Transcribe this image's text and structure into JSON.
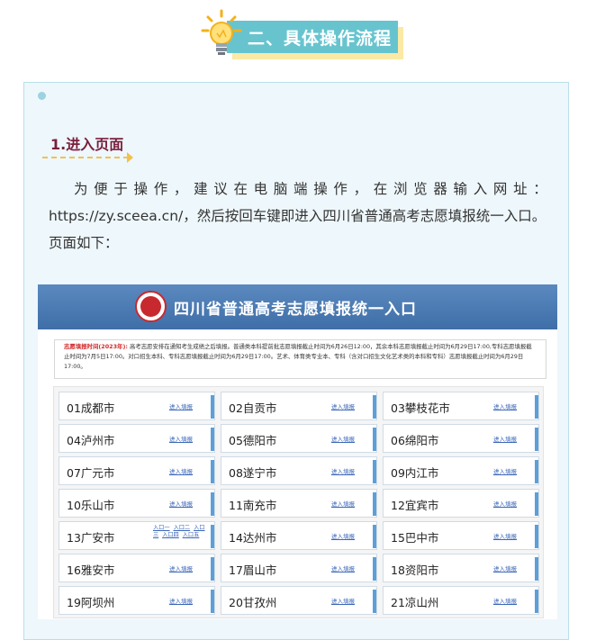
{
  "header": {
    "title": "二、具体操作流程",
    "bulb_icon": "lightbulb-icon",
    "accent_color": "#67c4cf",
    "shadow_color": "#fbe9a5"
  },
  "section": {
    "title": "1.进入页面",
    "title_color": "#7a1f3d",
    "para_line1": "为便于操作，建议在电脑端操作，在浏览器输入网址：",
    "para_rest": "https://zy.sceea.cn/，然后按回车键即进入四川省普通高考志愿填报统一入口。页面如下："
  },
  "screenshot": {
    "site_title": "四川省普通高考志愿填报统一入口",
    "notice_lead": "志愿填报时间(2023年):",
    "notice_text": " 高考志愿安排在通知考生成绩之后填报。普通类本科提前批志愿填报截止时间为6月26日12:00，其余本科志愿填报截止时间为6月29日17:00,专科志愿填报截止时间为7月5日17:00。对口招生本科、专科志愿填报截止时间为6月29日17:00。艺术、体育类专业本、专科（含对口招生文化艺术类的本科和专科）志愿填报截止时间为6月29日17:00。",
    "cities": [
      {
        "name": "01成都市",
        "link": "进入填报"
      },
      {
        "name": "02自贡市",
        "link": "进入填报"
      },
      {
        "name": "03攀枝花市",
        "link": "进入填报"
      },
      {
        "name": "04泸州市",
        "link": "进入填报"
      },
      {
        "name": "05德阳市",
        "link": "进入填报"
      },
      {
        "name": "06绵阳市",
        "link": "进入填报"
      },
      {
        "name": "07广元市",
        "link": "进入填报"
      },
      {
        "name": "08遂宁市",
        "link": "进入填报"
      },
      {
        "name": "09内江市",
        "link": "进入填报"
      },
      {
        "name": "10乐山市",
        "link": "进入填报"
      },
      {
        "name": "11南充市",
        "link": "进入填报"
      },
      {
        "name": "12宜宾市",
        "link": "进入填报"
      },
      {
        "name": "13广安市",
        "links": [
          "入口一",
          "入口二",
          "入口三",
          "入口四",
          "入口五"
        ]
      },
      {
        "name": "14达州市",
        "link": "进入填报"
      },
      {
        "name": "15巴中市",
        "link": "进入填报"
      },
      {
        "name": "16雅安市",
        "link": "进入填报"
      },
      {
        "name": "17眉山市",
        "link": "进入填报"
      },
      {
        "name": "18资阳市",
        "link": "进入填报"
      },
      {
        "name": "19阿坝州",
        "link": "进入填报"
      },
      {
        "name": "20甘孜州",
        "link": "进入填报"
      },
      {
        "name": "21凉山州",
        "link": "进入填报"
      }
    ]
  }
}
